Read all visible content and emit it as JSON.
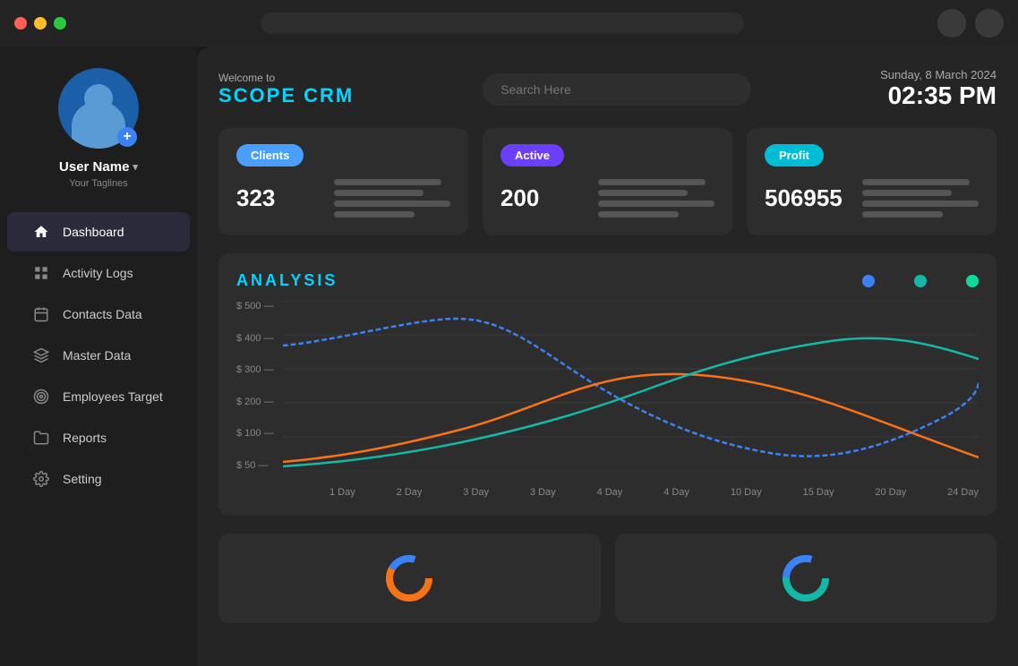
{
  "titlebar": {
    "dots": [
      "red",
      "yellow",
      "green"
    ]
  },
  "sidebar": {
    "user": {
      "name": "User Name",
      "tagline": "Your Taglines"
    },
    "nav_items": [
      {
        "id": "dashboard",
        "label": "Dashboard",
        "icon": "home-icon",
        "active": true
      },
      {
        "id": "activity-logs",
        "label": "Activity Logs",
        "icon": "grid-icon",
        "active": false
      },
      {
        "id": "contacts-data",
        "label": "Contacts Data",
        "icon": "calendar-icon",
        "active": false
      },
      {
        "id": "master-data",
        "label": "Master Data",
        "icon": "layers-icon",
        "active": false
      },
      {
        "id": "employees-target",
        "label": "Employees Target",
        "icon": "target-icon",
        "active": false
      },
      {
        "id": "reports",
        "label": "Reports",
        "icon": "folder-icon",
        "active": false
      },
      {
        "id": "setting",
        "label": "Setting",
        "icon": "gear-icon",
        "active": false
      }
    ]
  },
  "header": {
    "welcome": "Welcome to",
    "title": "SCOPE CRM",
    "search_placeholder": "Search Here",
    "date_label": "Sunday,",
    "date": "8 March 2024",
    "time": "02:35 PM"
  },
  "stats": [
    {
      "id": "clients",
      "badge": "Clients",
      "badge_class": "badge-clients",
      "value": "323"
    },
    {
      "id": "active",
      "badge": "Active",
      "badge_class": "badge-active",
      "value": "200"
    },
    {
      "id": "profit",
      "badge": "Profit",
      "badge_class": "badge-profit",
      "value": "506955"
    }
  ],
  "analysis": {
    "title": "ANALYSIS",
    "legend": [
      {
        "color": "#3b82f6",
        "label": ""
      },
      {
        "color": "#14b8a6",
        "label": ""
      },
      {
        "color": "#10b981",
        "label": ""
      }
    ],
    "y_labels": [
      "$ 500",
      "$ 400",
      "$ 300",
      "$ 200",
      "$ 100",
      "$ 50"
    ],
    "x_labels": [
      "1 Day",
      "2 Day",
      "3 Day",
      "3 Day",
      "4 Day",
      "4 Day",
      "10 Day",
      "15 Day",
      "20 Day",
      "24 Day"
    ]
  }
}
